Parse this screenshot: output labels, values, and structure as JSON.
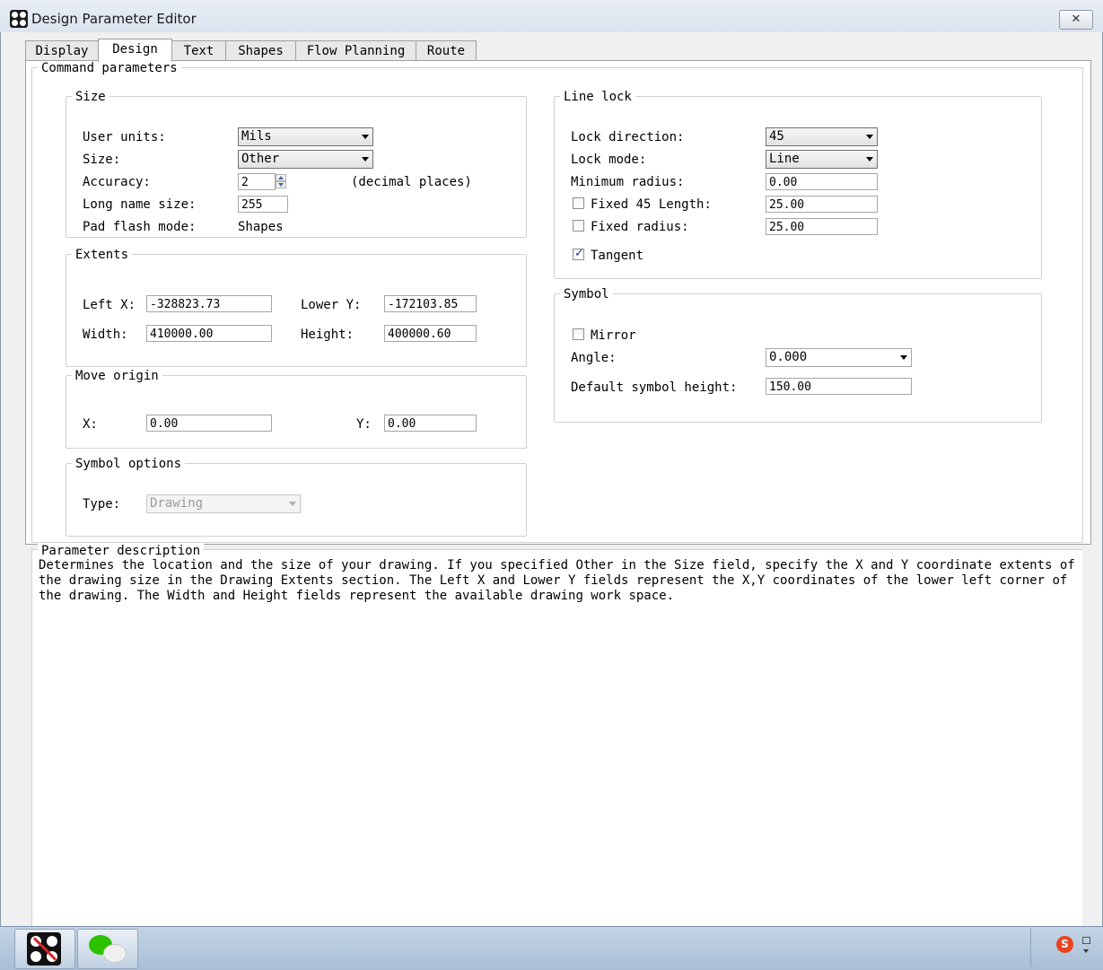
{
  "window": {
    "title": "Design Parameter Editor",
    "close_symbol": "✕"
  },
  "tabs": [
    "Display",
    "Design",
    "Text",
    "Shapes",
    "Flow Planning",
    "Route"
  ],
  "active_tab": "Design",
  "command_parameters": {
    "legend": "Command parameters",
    "size": {
      "legend": "Size",
      "user_units_label": "User units:",
      "user_units_value": "Mils",
      "size_label": "Size:",
      "size_value": "Other",
      "accuracy_label": "Accuracy:",
      "accuracy_value": "2",
      "accuracy_suffix": "(decimal places)",
      "long_name_label": "Long name size:",
      "long_name_value": "255",
      "pad_flash_label": "Pad flash mode:",
      "pad_flash_value": "Shapes"
    },
    "extents": {
      "legend": "Extents",
      "left_x_label": "Left X:",
      "left_x_value": "-328823.73",
      "lower_y_label": "Lower Y:",
      "lower_y_value": "-172103.85",
      "width_label": "Width:",
      "width_value": "410000.00",
      "height_label": "Height:",
      "height_value": "400000.60"
    },
    "move_origin": {
      "legend": "Move origin",
      "x_label": "X:",
      "x_value": "0.00",
      "y_label": "Y:",
      "y_value": "0.00"
    },
    "symbol_options": {
      "legend": "Symbol options",
      "type_label": "Type:",
      "type_value": "Drawing"
    },
    "line_lock": {
      "legend": "Line lock",
      "lock_direction_label": "Lock direction:",
      "lock_direction_value": "45",
      "lock_mode_label": "Lock mode:",
      "lock_mode_value": "Line",
      "min_radius_label": "Minimum radius:",
      "min_radius_value": "0.00",
      "fixed45_label": "Fixed 45 Length:",
      "fixed45_value": "25.00",
      "fixed45_checked": false,
      "fixed_radius_label": "Fixed radius:",
      "fixed_radius_value": "25.00",
      "fixed_radius_checked": false,
      "tangent_label": "Tangent",
      "tangent_checked": true
    },
    "symbol": {
      "legend": "Symbol",
      "mirror_label": "Mirror",
      "mirror_checked": false,
      "angle_label": "Angle:",
      "angle_value": "0.000",
      "default_height_label": "Default symbol height:",
      "default_height_value": "150.00"
    }
  },
  "parameter_description": {
    "legend": "Parameter description",
    "text": "Determines the location and the size of your drawing. If you specified Other in the Size field, specify the X and Y coordinate extents of\nthe drawing size in the Drawing Extents section. The Left X and Lower Y fields represent the X,Y coordinates of the lower left corner of\nthe drawing. The Width and Height fields represent the available drawing work space."
  },
  "taskbar": {
    "tray_logo_text": "S"
  },
  "colors": {
    "title_gradient_top": "#e9eef5",
    "taskbar": "#b7c9dc",
    "check_mark": "#1f3f8a",
    "tray_logo": "#e8441f"
  }
}
